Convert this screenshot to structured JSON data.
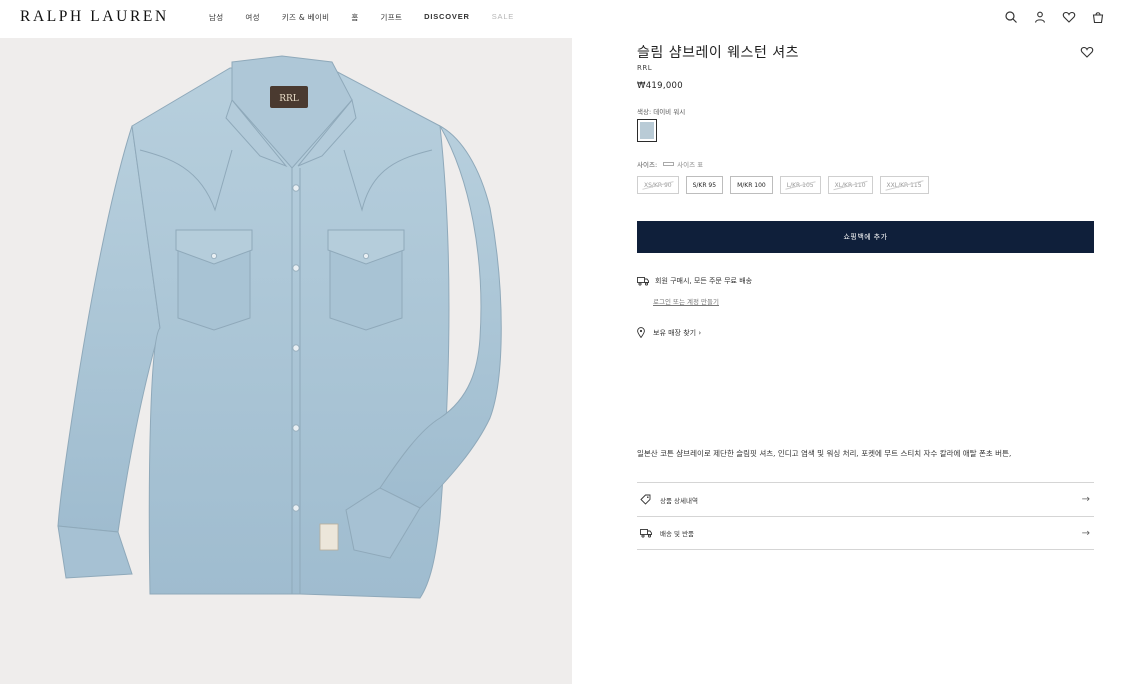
{
  "header": {
    "logo": "RALPH LAUREN",
    "nav": [
      {
        "label": "남성"
      },
      {
        "label": "여성"
      },
      {
        "label": "키즈 & 베이비"
      },
      {
        "label": "홈"
      },
      {
        "label": "기프트"
      },
      {
        "label": "DISCOVER"
      },
      {
        "label": "SALE"
      }
    ],
    "icons": [
      "search-icon",
      "account-icon",
      "wishlist-icon",
      "cart-icon"
    ]
  },
  "product": {
    "title": "슬림 샴브레이 웨스턴 셔츠",
    "brand": "RRL",
    "price": "₩419,000",
    "color_label": "색상: 데이비 워시",
    "swatch_color": "#b9cbd6",
    "size_label": "사이즈:",
    "size_guide": "사이즈 표",
    "sizes": [
      {
        "label": "XS/KR 90",
        "available": false
      },
      {
        "label": "S/KR 95",
        "available": true
      },
      {
        "label": "M/KR 100",
        "available": true
      },
      {
        "label": "L/KR 105",
        "available": false
      },
      {
        "label": "XL/KR 110",
        "available": false
      },
      {
        "label": "XXL/KR 115",
        "available": false
      }
    ],
    "add_to_cart": "쇼핑백에 추가",
    "shipping_text": "회원 구매시, 모든 주문 무료 배송",
    "login_link": "로그인 또는 계정 만들기",
    "store_text": "보유 매장 찾기 ›",
    "description": "일본산 코튼 샴브레이로 제단한 슬림핏 셔츠, 인디고 염색 및 워싱 처리, 포켓에 무트 스티치 자수 칼라에 애탈 폰초 버튼,",
    "accordion": [
      {
        "label": "상품 상세내역",
        "icon": "tag-icon"
      },
      {
        "label": "배송 및 반품",
        "icon": "truck-icon"
      }
    ],
    "accordion_arrow": "→"
  },
  "colors": {
    "button_bg": "#0f1f3a",
    "image_bg": "#efedec",
    "shirt": "#a9c3d3"
  }
}
